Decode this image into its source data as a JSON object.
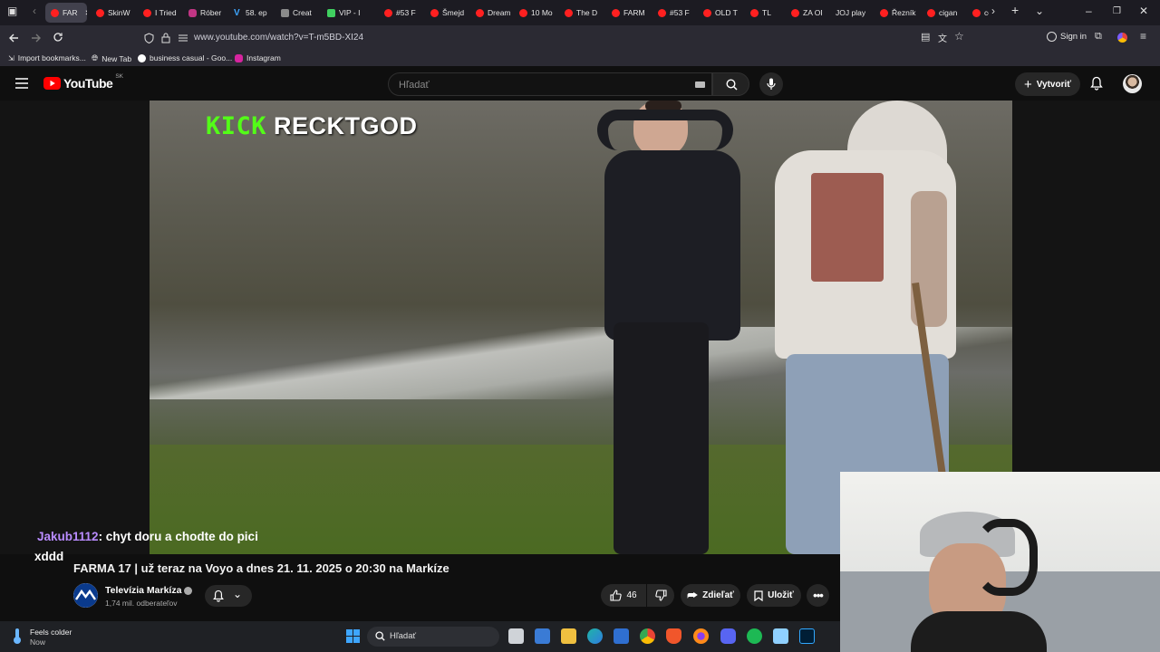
{
  "browser": {
    "tabs": [
      {
        "label": "FAR",
        "icon": "youtube-icon",
        "active": true
      },
      {
        "label": "SkinW",
        "icon": "youtube-icon"
      },
      {
        "label": "I Tried",
        "icon": "youtube-icon"
      },
      {
        "label": "Róber",
        "icon": "instagram-icon"
      },
      {
        "label": "58. ep",
        "icon": "v-icon"
      },
      {
        "label": "Creat",
        "icon": "document-icon"
      },
      {
        "label": "VIP - I",
        "icon": "vip-icon"
      },
      {
        "label": "#53 F",
        "icon": "youtube-icon"
      },
      {
        "label": "Šmejd",
        "icon": "youtube-icon"
      },
      {
        "label": "Dream",
        "icon": "youtube-icon"
      },
      {
        "label": "10 Mo",
        "icon": "youtube-icon"
      },
      {
        "label": "The D",
        "icon": "youtube-icon"
      },
      {
        "label": "FARM",
        "icon": "youtube-icon"
      },
      {
        "label": "#53 F",
        "icon": "youtube-icon"
      },
      {
        "label": "OLD T",
        "icon": "youtube-icon"
      },
      {
        "label": "TL",
        "icon": "youtube-icon"
      },
      {
        "label": "ZA OF",
        "icon": "youtube-icon"
      },
      {
        "label": "JOJ play",
        "icon": "none"
      },
      {
        "label": "Řezník",
        "icon": "youtube-icon"
      },
      {
        "label": "cigan",
        "icon": "youtube-icon"
      },
      {
        "label": "co",
        "icon": "youtube-icon"
      }
    ],
    "url": "www.youtube.com/watch?v=T-m5BD-XI24",
    "sign_in": "Sign in",
    "bookmarks": [
      {
        "label": "Import bookmarks...",
        "icon": "import-icon"
      },
      {
        "label": "New Tab",
        "icon": "globe-icon"
      },
      {
        "label": "business casual - Goo...",
        "icon": "google-icon"
      },
      {
        "label": "Instagram",
        "icon": "instagram-icon"
      }
    ]
  },
  "youtube": {
    "logo_text": "YouTube",
    "logo_region": "SK",
    "search_placeholder": "Hľadať",
    "create_label": "Vytvoriť"
  },
  "video": {
    "overlay_kick": "KICK",
    "overlay_channel": "RECKTGOD",
    "chat_user": "Jakub1112",
    "chat_message": ": chyt doru a chodte do pici",
    "chat_message_2": "xddd",
    "title": "FARMA 17 | už teraz na Voyo a dnes 21. 11. 2025 o 20:30 na Markíze",
    "channel_name": "Televízia Markíza",
    "subscribers": "1,74 mil. odberateľov",
    "likes": "46",
    "share_label": "Zdieľať",
    "save_label": "Uložiť"
  },
  "taskbar": {
    "weather_title": "Feels colder",
    "weather_sub": "Now",
    "search_placeholder": "Hľadať"
  }
}
